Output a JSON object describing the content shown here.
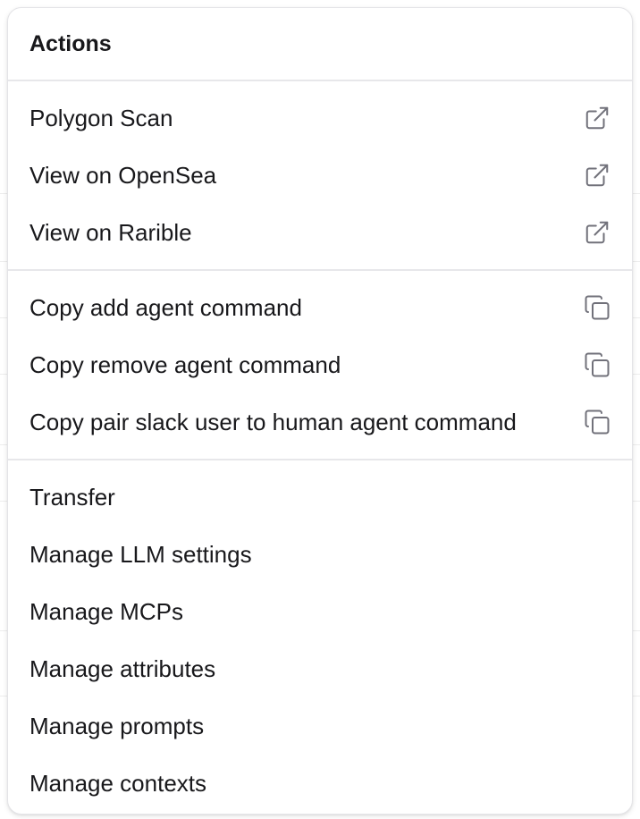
{
  "menu": {
    "title": "Actions",
    "groups": [
      {
        "items": [
          {
            "label": "Polygon Scan",
            "icon": "external-link-icon"
          },
          {
            "label": "View on OpenSea",
            "icon": "external-link-icon"
          },
          {
            "label": "View on Rarible",
            "icon": "external-link-icon"
          }
        ]
      },
      {
        "items": [
          {
            "label": "Copy add agent command",
            "icon": "copy-icon"
          },
          {
            "label": "Copy remove agent command",
            "icon": "copy-icon"
          },
          {
            "label": "Copy pair slack user to human agent command",
            "icon": "copy-icon"
          }
        ]
      },
      {
        "items": [
          {
            "label": "Transfer"
          },
          {
            "label": "Manage LLM settings"
          },
          {
            "label": "Manage MCPs"
          },
          {
            "label": "Manage attributes"
          },
          {
            "label": "Manage prompts"
          },
          {
            "label": "Manage contexts"
          }
        ]
      }
    ]
  },
  "colors": {
    "text": "#18181b",
    "icon": "#71717a",
    "border": "#e4e4e7"
  }
}
